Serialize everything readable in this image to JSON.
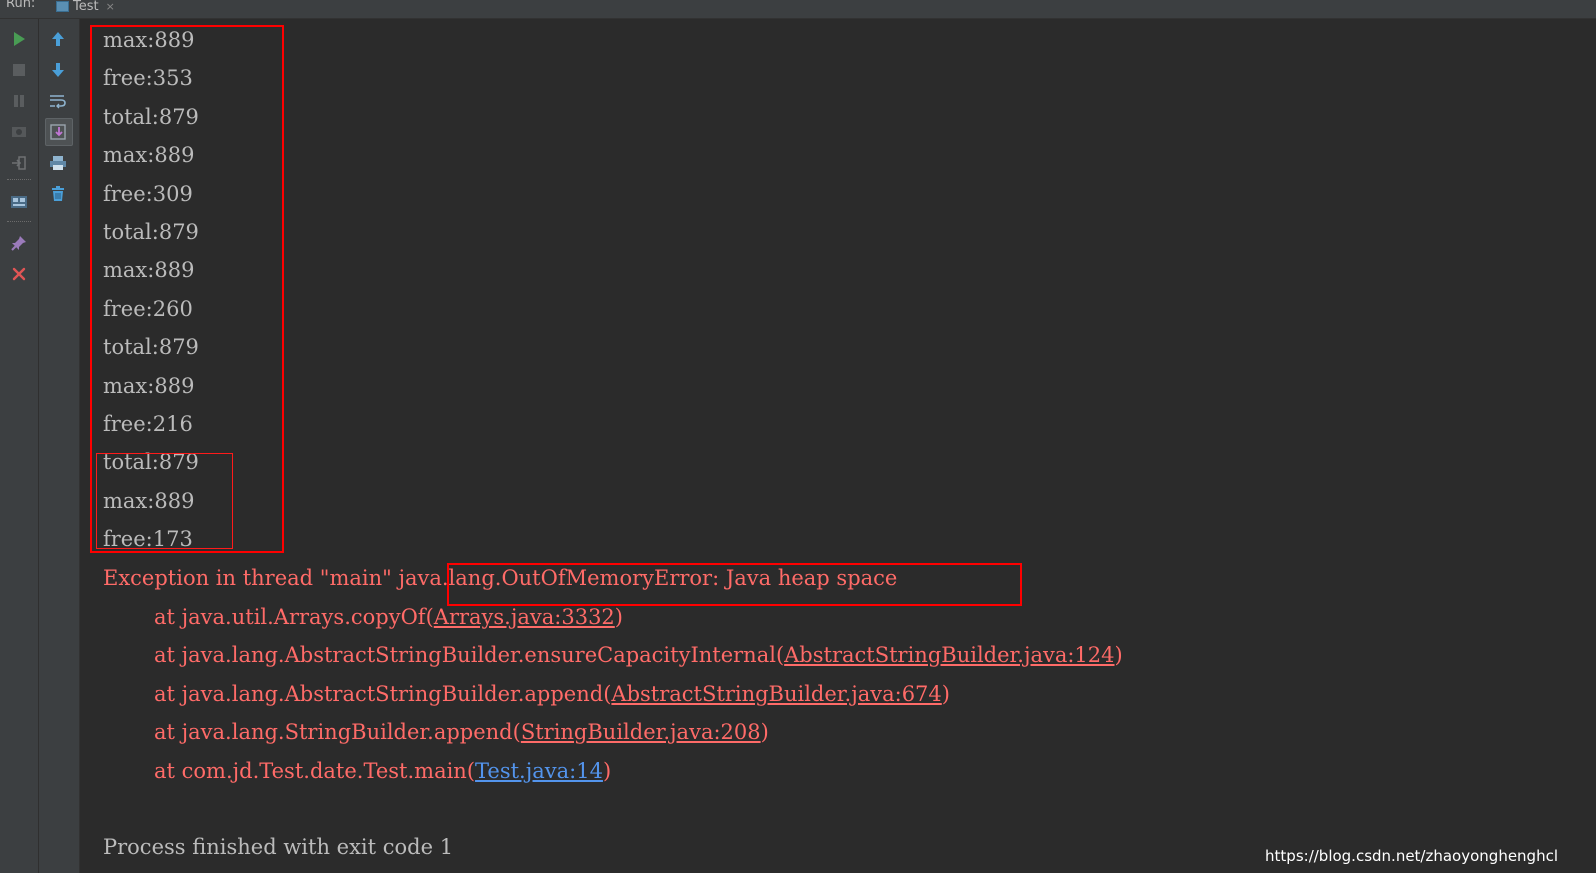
{
  "run_panel": {
    "label": "Run:",
    "tab_label": "Test",
    "tab_close": "×"
  },
  "toolbar_outer": [
    {
      "name": "rerun-icon"
    },
    {
      "name": "stop-icon"
    },
    {
      "name": "pause-icon"
    },
    {
      "name": "dump-threads-icon"
    },
    {
      "name": "exit-icon"
    },
    {
      "name": "restore-layout-icon"
    },
    {
      "name": "pin-icon"
    },
    {
      "name": "close-icon"
    }
  ],
  "toolbar_inner": [
    {
      "name": "up-arrow-icon"
    },
    {
      "name": "down-arrow-icon"
    },
    {
      "name": "soft-wrap-icon"
    },
    {
      "name": "scroll-to-end-icon"
    },
    {
      "name": "print-icon"
    },
    {
      "name": "clear-all-icon"
    }
  ],
  "console": {
    "output_lines": [
      "max:889",
      "free:353",
      "total:879",
      "max:889",
      "free:309",
      "total:879",
      "max:889",
      "free:260",
      "total:879",
      "max:889",
      "free:216",
      "total:879",
      "max:889",
      "free:173"
    ],
    "exception": {
      "prefix": "Exception in thread \"main\" ",
      "error": "java.lang.OutOfMemoryError: Java heap space"
    },
    "stack": [
      {
        "at": "at java.util.Arrays.copyOf(",
        "link": "Arrays.java:3332",
        "close": ")"
      },
      {
        "at": "at java.lang.AbstractStringBuilder.ensureCapacityInternal(",
        "link": "AbstractStringBuilder.java:124",
        "close": ")"
      },
      {
        "at": "at java.lang.AbstractStringBuilder.append(",
        "link": "AbstractStringBuilder.java:674",
        "close": ")"
      },
      {
        "at": "at java.lang.StringBuilder.append(",
        "link": "StringBuilder.java:208",
        "close": ")"
      },
      {
        "at": "at com.jd.Test.date.Test.main(",
        "link": "Test.java:14",
        "close": ")"
      }
    ],
    "process_finished": "Process finished with exit code 1"
  },
  "watermark": "https://blog.csdn.net/zhaoyonghenghcl",
  "colors": {
    "background": "#2b2b2b",
    "output_text": "#bbbbbb",
    "error_text": "#ff6b68",
    "user_code_link": "#5394ec",
    "highlight_box": "#ff0000"
  }
}
